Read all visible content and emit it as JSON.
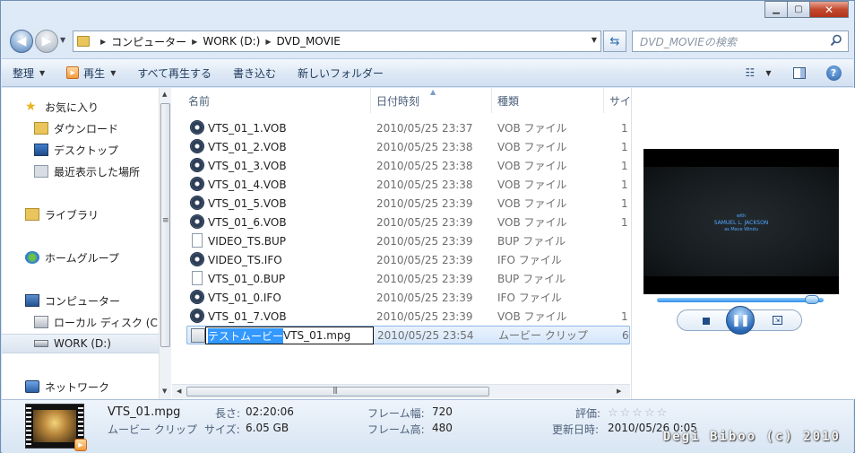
{
  "window": {
    "minimize": "▁",
    "maximize": "▢",
    "close": "✕"
  },
  "address": {
    "crumbs": [
      "コンピューター",
      "WORK (D:)",
      "DVD_MOVIE"
    ]
  },
  "search": {
    "placeholder": "DVD_MOVIEの検索"
  },
  "toolbar": {
    "organize": "整理",
    "play": "再生",
    "play_all": "すべて再生する",
    "burn": "書き込む",
    "new_folder": "新しいフォルダー"
  },
  "nav": {
    "favorites": "お気に入り",
    "downloads": "ダウンロード",
    "desktop": "デスクトップ",
    "recent": "最近表示した場所",
    "libraries": "ライブラリ",
    "homegroup": "ホームグループ",
    "computer": "コンピューター",
    "local_disk": "ローカル ディスク (C",
    "work": "WORK (D:)",
    "network": "ネットワーク"
  },
  "columns": {
    "name": "名前",
    "date": "日付時刻",
    "type": "種類",
    "size": "サイ"
  },
  "files": [
    {
      "name": "VTS_01_1.VOB",
      "date": "2010/05/25 23:37",
      "type": "VOB ファイル",
      "size": "1",
      "icon": "dvd-icon"
    },
    {
      "name": "VTS_01_2.VOB",
      "date": "2010/05/25 23:38",
      "type": "VOB ファイル",
      "size": "1",
      "icon": "dvd-icon"
    },
    {
      "name": "VTS_01_3.VOB",
      "date": "2010/05/25 23:38",
      "type": "VOB ファイル",
      "size": "1",
      "icon": "dvd-icon"
    },
    {
      "name": "VTS_01_4.VOB",
      "date": "2010/05/25 23:38",
      "type": "VOB ファイル",
      "size": "1",
      "icon": "dvd-icon"
    },
    {
      "name": "VTS_01_5.VOB",
      "date": "2010/05/25 23:39",
      "type": "VOB ファイル",
      "size": "1",
      "icon": "dvd-icon"
    },
    {
      "name": "VTS_01_6.VOB",
      "date": "2010/05/25 23:39",
      "type": "VOB ファイル",
      "size": "1",
      "icon": "dvd-icon"
    },
    {
      "name": "VIDEO_TS.BUP",
      "date": "2010/05/25 23:39",
      "type": "BUP ファイル",
      "size": "",
      "icon": "document-icon"
    },
    {
      "name": "VIDEO_TS.IFO",
      "date": "2010/05/25 23:39",
      "type": "IFO ファイル",
      "size": "",
      "icon": "dvd-icon"
    },
    {
      "name": "VTS_01_0.BUP",
      "date": "2010/05/25 23:39",
      "type": "BUP ファイル",
      "size": "",
      "icon": "document-icon"
    },
    {
      "name": "VTS_01_0.IFO",
      "date": "2010/05/25 23:39",
      "type": "IFO ファイル",
      "size": "",
      "icon": "dvd-icon"
    },
    {
      "name": "VTS_01_7.VOB",
      "date": "2010/05/25 23:39",
      "type": "VOB ファイル",
      "size": "1",
      "icon": "dvd-icon"
    }
  ],
  "selected_file": {
    "rename_selected": "テストムービー",
    "rename_rest": "VTS_01.mpg",
    "date": "2010/05/25 23:54",
    "type": "ムービー クリップ",
    "size": "6"
  },
  "preview": {
    "credit_with": "with",
    "credit_name": "SAMUEL L. JACKSON",
    "credit_role": "as Mace Windu",
    "seek_fraction": 0.93
  },
  "details": {
    "filename": "VTS_01.mpg",
    "filetype": "ムービー クリップ",
    "length_label": "長さ:",
    "length_value": "02:20:06",
    "size_label": "サイズ:",
    "size_value": "6.05 GB",
    "frame_width_label": "フレーム幅:",
    "frame_width_value": "720",
    "frame_height_label": "フレーム高:",
    "frame_height_value": "480",
    "rating_label": "評価:",
    "rating_stars": "☆☆☆☆☆",
    "modified_label": "更新日時:",
    "modified_value": "2010/05/26 0:05"
  },
  "watermark": "Degi Biboo (c) 2010"
}
